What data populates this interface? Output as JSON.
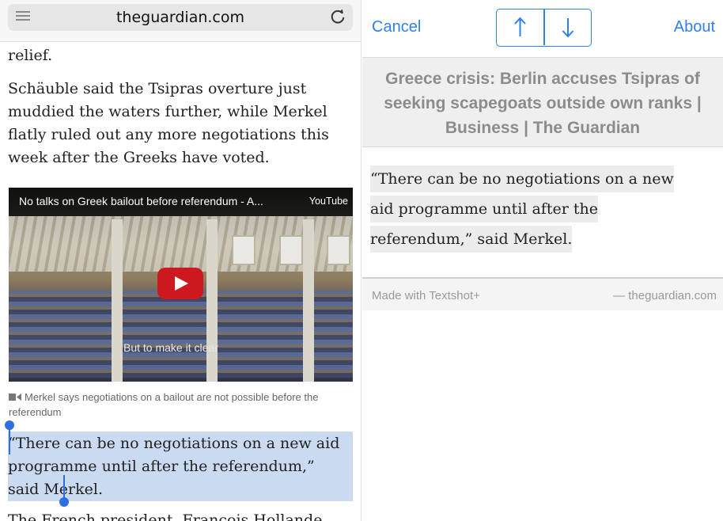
{
  "browser": {
    "url": "theguardian.com",
    "article": {
      "para_tail": "relief.",
      "para_quote": "Schäuble said the Tsipras overture just muddied the waters further, while Merkel flatly ruled out any more negotiations this week after the Greeks have voted.",
      "video": {
        "title": "No talks on Greek bailout before referendum - A...",
        "provider": "YouTube",
        "subtitle": "But to make it clear"
      },
      "caption": "Merkel says negotiations on a bailout are not possible before the referendum",
      "selected_quote": "“There can be no negotiations on a new aid programme until after the referendum,” said Merkel.",
      "next_para": "The French president, François Hollande"
    }
  },
  "textshot": {
    "cancel_label": "Cancel",
    "about_label": "About",
    "title": "Greece crisis: Berlin accuses Tsipras of seeking scapegoats outside own ranks | Business | The Guardian",
    "quote": "“There can be no negotiations on a new aid programme until after the referendum,” said Merkel.",
    "footer_left": "Made with Textshot+",
    "footer_right": "— theguardian.com",
    "accent_color": "#2f80ed",
    "selection_color": "#c9daf1"
  }
}
